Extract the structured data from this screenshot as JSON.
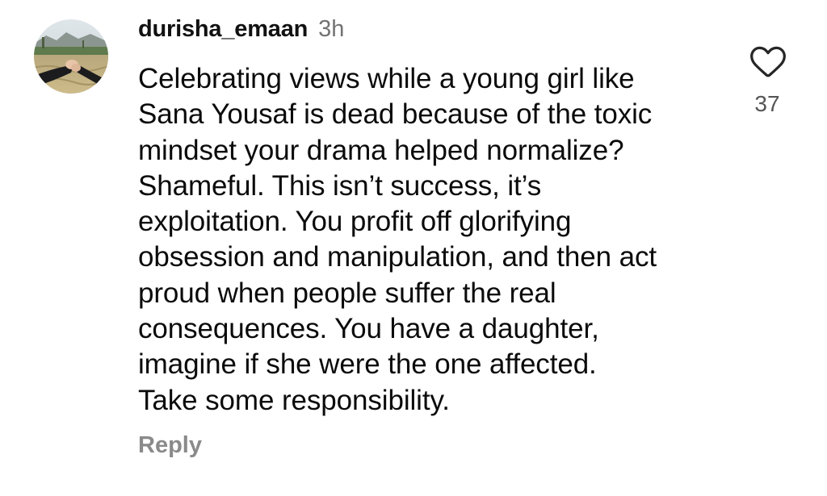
{
  "comment": {
    "username": "durisha_emaan",
    "timestamp": "3h",
    "text_lines": [
      "Celebrating views while a young girl like",
      "Sana Yousaf is dead because of the toxic",
      "mindset your drama helped normalize?",
      "Shameful. This isn’t success, it’s",
      "exploitation. You profit off glorifying",
      "obsession and manipulation, and then act",
      "proud when people suffer the real",
      "consequences. You have a daughter,",
      "imagine if she were the one affected.",
      "Take some responsibility."
    ],
    "like_count": "37",
    "reply_label": "Reply",
    "like_icon": "heart-outline-icon"
  },
  "colors": {
    "username": "#111111",
    "timestamp": "#737373",
    "body": "#0b0b0b",
    "reply": "#8a8a8a",
    "like_icon": "#262626"
  }
}
